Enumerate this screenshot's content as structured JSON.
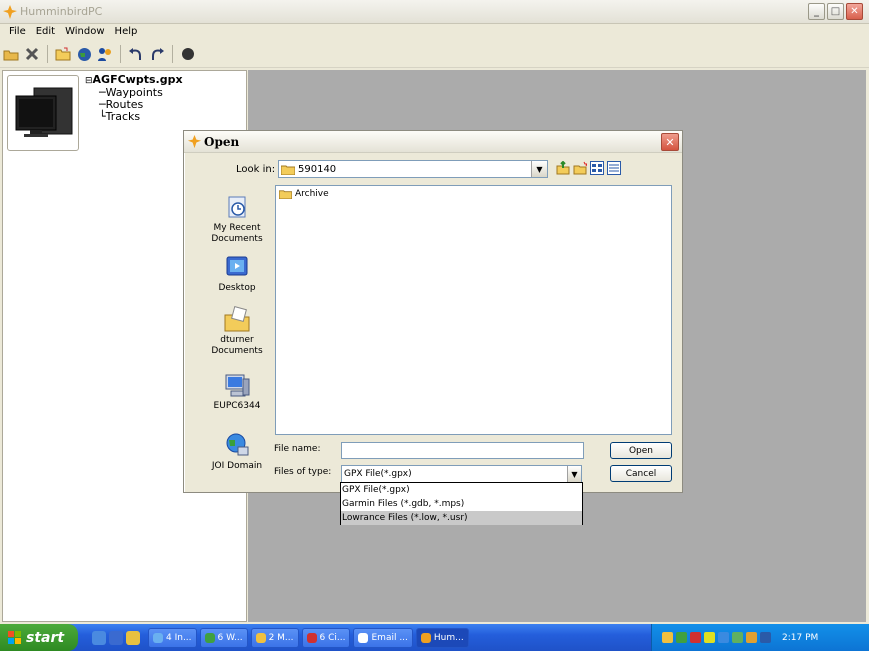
{
  "app": {
    "title": "HumminbirdPC",
    "menu": [
      "File",
      "Edit",
      "Window",
      "Help"
    ],
    "toolbar_icons": [
      "open-folder-icon",
      "delete-icon",
      "folder-open-icon",
      "globe-icon",
      "people-icon",
      "undo-icon",
      "redo-icon",
      "record-icon"
    ]
  },
  "tree": {
    "root": "AGFCwpts.gpx",
    "children": [
      "Waypoints",
      "Routes",
      "Tracks"
    ]
  },
  "dialog": {
    "title": "Open",
    "look_in_label": "Look in:",
    "look_in_value": "590140",
    "places": [
      {
        "label": "My Recent Documents",
        "icon": "recent-documents-icon"
      },
      {
        "label": "Desktop",
        "icon": "desktop-icon"
      },
      {
        "label": "dturner Documents",
        "icon": "documents-icon"
      },
      {
        "label": "EUPC6344",
        "icon": "computer-icon"
      },
      {
        "label": "JOI Domain",
        "icon": "network-icon"
      }
    ],
    "files": [
      "Archive"
    ],
    "file_name_label": "File name:",
    "file_name_value": "",
    "files_of_type_label": "Files of type:",
    "files_of_type_value": "GPX File(*.gpx)",
    "type_options": [
      "GPX File(*.gpx)",
      "Garmin Files (*.gdb, *.mps)",
      "Lowrance Files (*.low, *.usr)"
    ],
    "highlighted_option": "Lowrance Files (*.low, *.usr)",
    "open_label": "Open",
    "cancel_label": "Cancel"
  },
  "taskbar": {
    "start_label": "start",
    "tasks": [
      "4 In...",
      "6 W...",
      "2 M...",
      "6 Ci...",
      "Email ...",
      "Hum..."
    ],
    "clock": "2:17 PM"
  },
  "colors": {
    "workspace": "#ababab",
    "taskbar": "#245edb",
    "start": "#2e8a22"
  }
}
